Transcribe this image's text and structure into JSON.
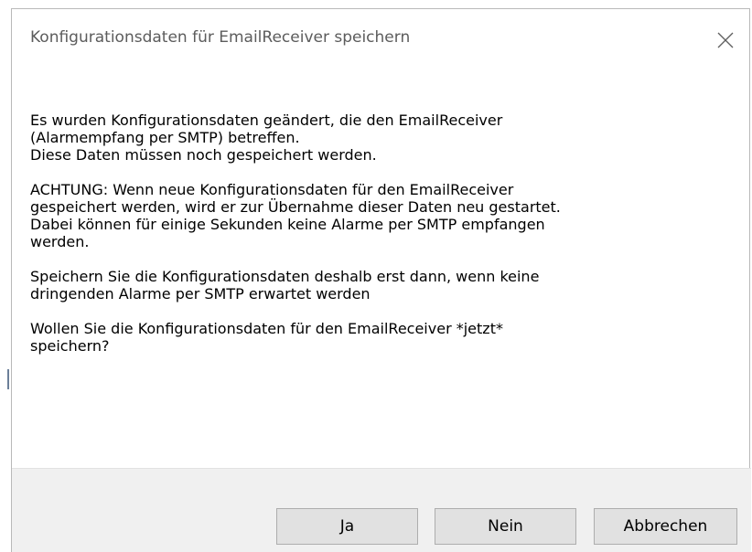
{
  "dialog": {
    "title": "Konfigurationsdaten für EmailReceiver speichern",
    "close_icon": "close-icon",
    "paragraphs": [
      "Es wurden Konfigurationsdaten geändert, die den EmailReceiver\n(Alarmempfang per SMTP) betreffen.\nDiese Daten müssen noch gespeichert werden.",
      "ACHTUNG: Wenn neue Konfigurationsdaten für den EmailReceiver\ngespeichert werden, wird er zur Übernahme dieser Daten neu gestartet.\nDabei können für einige Sekunden keine Alarme per SMTP empfangen\nwerden.",
      "Speichern Sie die Konfigurationsdaten deshalb erst dann, wenn keine\ndringenden Alarme per SMTP erwartet werden",
      "Wollen Sie die Konfigurationsdaten für den EmailReceiver *jetzt*\nspeichern?"
    ],
    "buttons": {
      "yes": "Ja",
      "no": "Nein",
      "cancel": "Abbrechen"
    }
  },
  "colors": {
    "title_text": "#5c5c5c",
    "footer_bg": "#f0f0f0",
    "button_bg": "#e1e1e1",
    "button_border": "#adadad"
  }
}
